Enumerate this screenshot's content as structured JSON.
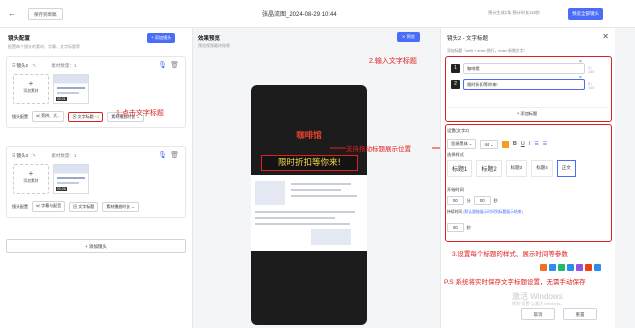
{
  "topbar": {
    "back_icon": "arrow-left-icon",
    "save_draft": "保存到草稿",
    "doc_title": "张晶流图_2024-08-29 10:44",
    "estimate": "预计生成1条  预计时长118秒",
    "preview_all": "预览全部镜头"
  },
  "left": {
    "title": "镜头配置",
    "subtitle": "配置每个镜头的素材、字幕、文字标题等",
    "add_shot": "+ 添加镜头",
    "shots": [
      {
        "name": "镜头2",
        "count": "素材数量：1",
        "add_material": "添加素材",
        "duration": "00:21",
        "config_label": "镜头配置",
        "subtitle_btn": "旁拼、大...",
        "title_btn": "文字标题",
        "title_count": "+1",
        "mode_select": "素材播放时长"
      },
      {
        "name": "镜头3",
        "count": "素材数量：1",
        "add_material": "添加素材",
        "duration": "00:26",
        "config_label": "镜头配置",
        "subtitle_btn": "字幕与配音",
        "title_btn": "文字标题",
        "mode_select": "素材播放时长"
      }
    ],
    "add_shot_bottom": "+ 添加镜头"
  },
  "annotations": {
    "a1": "1.点击文字标题",
    "a2": "2.输入文字标题",
    "a3": "支持拖动标题展示位置",
    "a4": "3.设置每个标题的样式、展示时间等参数",
    "a5": "P.S 系统将实时保存文字标题设置，无需手动保存"
  },
  "middle": {
    "title": "效果预览",
    "subtitle": "预览视频最终效果",
    "preview_btn": "预览",
    "title_line1": "咖啡馆",
    "title_line2": "限时折扣等你来!"
  },
  "right": {
    "title": "镜头2 - 文字标题",
    "hint": "添加标题（shift + enter 换行，enter 新增文字）",
    "titles": [
      {
        "index": "1",
        "text": "咖啡馆",
        "count": "3 / 100"
      },
      {
        "index": "2",
        "text": "限时折扣等你来!",
        "count": "8 / 100"
      }
    ],
    "add_title": "+ 添加标题",
    "setting_label": "设置(文字2)",
    "font": "思源黑体",
    "font_size": "44",
    "style_label": "选择样式",
    "styles": [
      "标题1",
      "标题2",
      "标题3",
      "标题4",
      "正文"
    ],
    "start_label": "开始时间",
    "start_min": "00",
    "start_sec": "00",
    "unit_min": "分",
    "unit_sec": "秒",
    "duration_label": "持续时间",
    "duration_note": "默认跟随展示时间到标题展示结束",
    "duration_val": "00",
    "cancel": "取消",
    "confirm": "重置"
  },
  "system": {
    "watermark": "激活 Windows",
    "watermark_sub": "转到\"设置\"以激活 Windows。"
  },
  "colors": {
    "accent": "#4a6cf7",
    "annotation": "#e02020"
  }
}
